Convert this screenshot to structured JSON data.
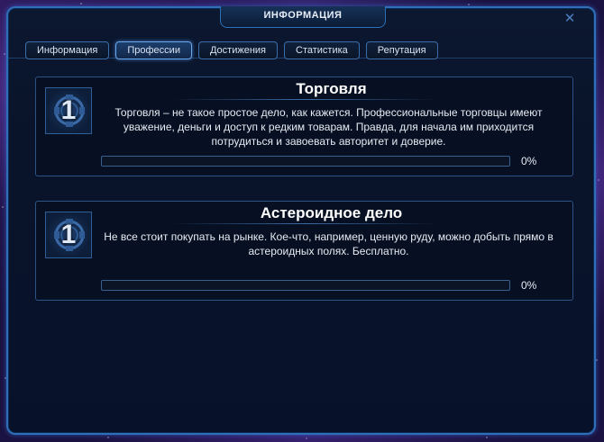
{
  "window": {
    "title": "ИНФОРМАЦИЯ",
    "close_icon": "close-icon"
  },
  "tabs": [
    {
      "label": "Информация",
      "active": false
    },
    {
      "label": "Профессии",
      "active": true
    },
    {
      "label": "Достижения",
      "active": false
    },
    {
      "label": "Статистика",
      "active": false
    },
    {
      "label": "Репутация",
      "active": false
    }
  ],
  "professions": [
    {
      "level": "1",
      "title": "Торговля",
      "description": "Торговля – не такое простое дело, как кажется. Профессиональные торговцы имеют уважение, деньги и доступ к редким товарам. Правда, для начала им приходится потрудиться и завоевать авторитет и доверие.",
      "progress": 0,
      "progress_label": "0%",
      "icon": "profession-emblem-icon"
    },
    {
      "level": "1",
      "title": "Астероидное дело",
      "description": "Не все стоит покупать на рынке. Кое-что, например, ценную руду, можно добыть прямо в астероидных полях. Бесплатно.",
      "progress": 0,
      "progress_label": "0%",
      "icon": "profession-emblem-icon"
    }
  ],
  "colors": {
    "accent": "#2f6fb8",
    "panel_bg": "#071022",
    "text": "#e6ebf3"
  }
}
